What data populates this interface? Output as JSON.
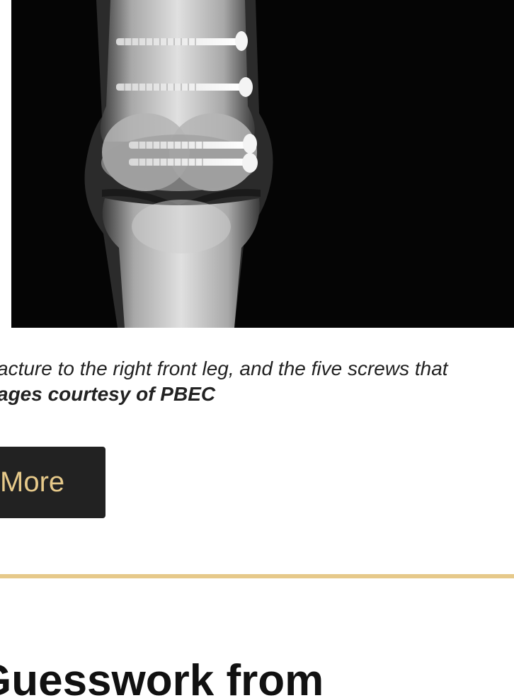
{
  "figure": {
    "description_icon": "xray-image-icon"
  },
  "caption": {
    "line1": "acture to the right front leg, and the five screws that",
    "line2": "ages courtesy of PBEC"
  },
  "read_more": {
    "label": "More"
  },
  "section": {
    "heading": "Guesswork from"
  },
  "colors": {
    "accent": "#e6c98a",
    "button_bg": "#222222",
    "image_bg": "#050505"
  }
}
